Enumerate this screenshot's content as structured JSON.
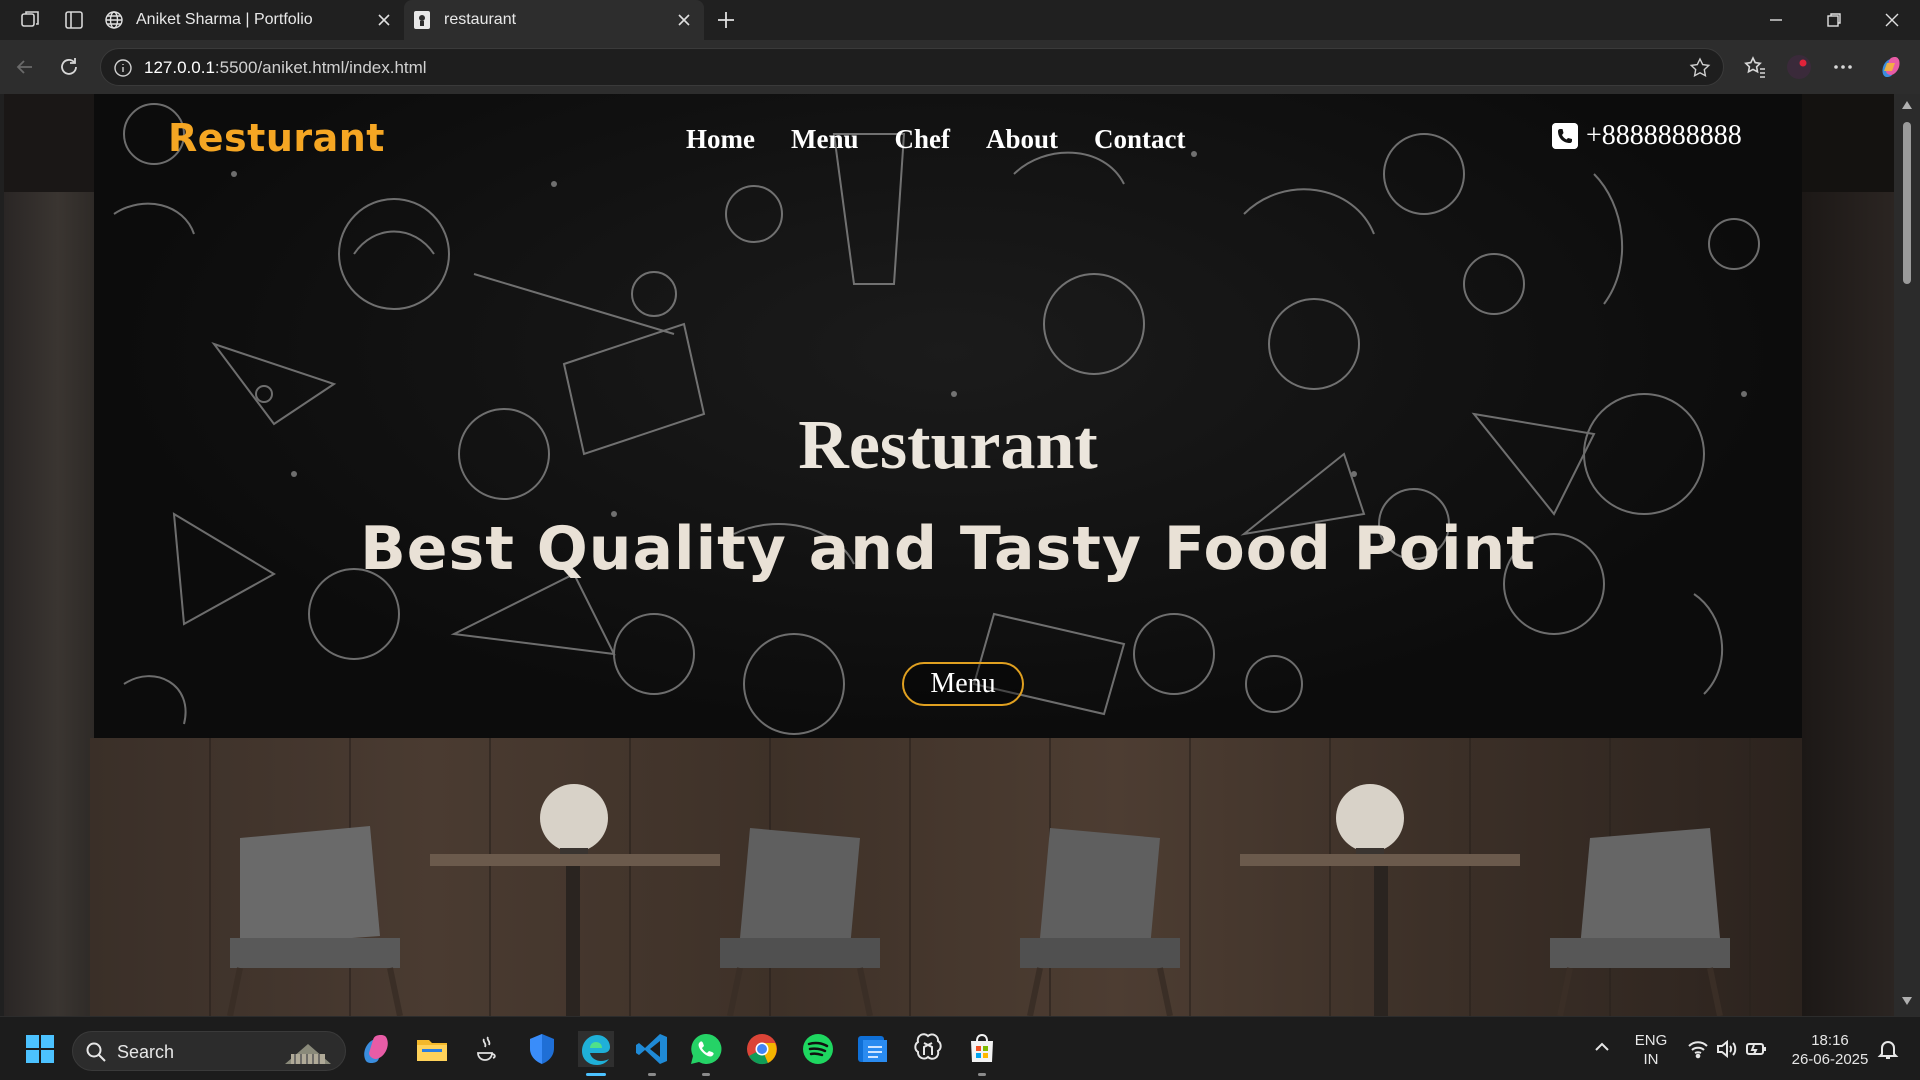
{
  "browser": {
    "tabs": [
      {
        "title": "Aniket Sharma | Portfolio",
        "active": false,
        "favicon": "globe-icon"
      },
      {
        "title": "restaurant",
        "active": true,
        "favicon": "page-icon"
      }
    ],
    "url_host": "127.0.0.1",
    "url_rest": ":5500/aniket.html/index.html"
  },
  "site": {
    "brand": "Resturant",
    "nav": [
      "Home",
      "Menu",
      "Chef",
      "About",
      "Contact"
    ],
    "phone": "+8888888888",
    "hero_title": "Resturant",
    "hero_subtitle": "Best Quality and Tasty Food Point",
    "hero_button": "Menu",
    "colors": {
      "brand": "#f5a623",
      "button_border": "#e0a020",
      "hero_text": "#ece6dd"
    }
  },
  "taskbar": {
    "search_label": "Search",
    "apps": [
      "copilot-icon",
      "file-explorer-icon",
      "java-icon",
      "defender-icon",
      "edge-icon",
      "vscode-icon",
      "whatsapp-icon",
      "chrome-icon",
      "spotify-icon",
      "notes-icon",
      "chatgpt-icon",
      "store-icon"
    ],
    "lang_top": "ENG",
    "lang_bottom": "IN",
    "time": "18:16",
    "date": "26-06-2025"
  }
}
